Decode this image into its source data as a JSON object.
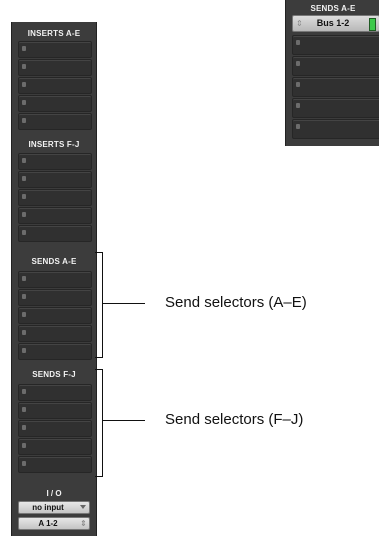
{
  "strip": {
    "inserts_ae": {
      "title": "INSERTS A-E",
      "slots": 5
    },
    "inserts_fj": {
      "title": "INSERTS F-J",
      "slots": 5
    },
    "sends_ae": {
      "title": "SENDS A-E",
      "slots": 5
    },
    "sends_fj": {
      "title": "SENDS F-J",
      "slots": 5
    },
    "io": {
      "title": "I / O",
      "input_label": "no input",
      "output_label": "A 1-2"
    }
  },
  "inset": {
    "title": "SENDS A-E",
    "bus_label": "Bus 1-2"
  },
  "callouts": {
    "sends_ae": "Send selectors (A–E)",
    "sends_fj": "Send selectors (F–J)"
  },
  "colors": {
    "strip_bg": "#3c3c3c",
    "meter_green": "#3cc94a"
  }
}
